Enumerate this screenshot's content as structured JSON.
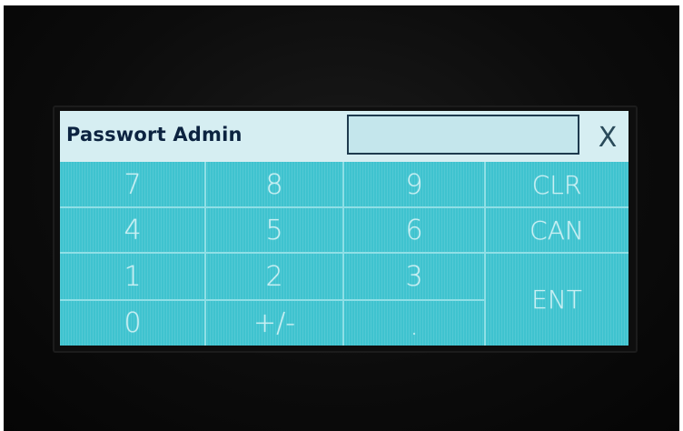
{
  "dialog": {
    "title": "Passwort Admin",
    "password_value": "",
    "close_label": "X"
  },
  "keypad": {
    "row1": [
      "7",
      "8",
      "9",
      "CLR"
    ],
    "row2": [
      "4",
      "5",
      "6",
      "CAN"
    ],
    "row3": [
      "1",
      "2",
      "3"
    ],
    "row4": [
      "0",
      "+/-",
      "."
    ],
    "enter_label": "ENT"
  },
  "colors": {
    "screen_bg": "#3fc3cf",
    "titlebar_bg": "#d6eef2",
    "title_text": "#0c2340",
    "key_text": "#c9eff3",
    "grid_line": "#8fdfe6"
  }
}
